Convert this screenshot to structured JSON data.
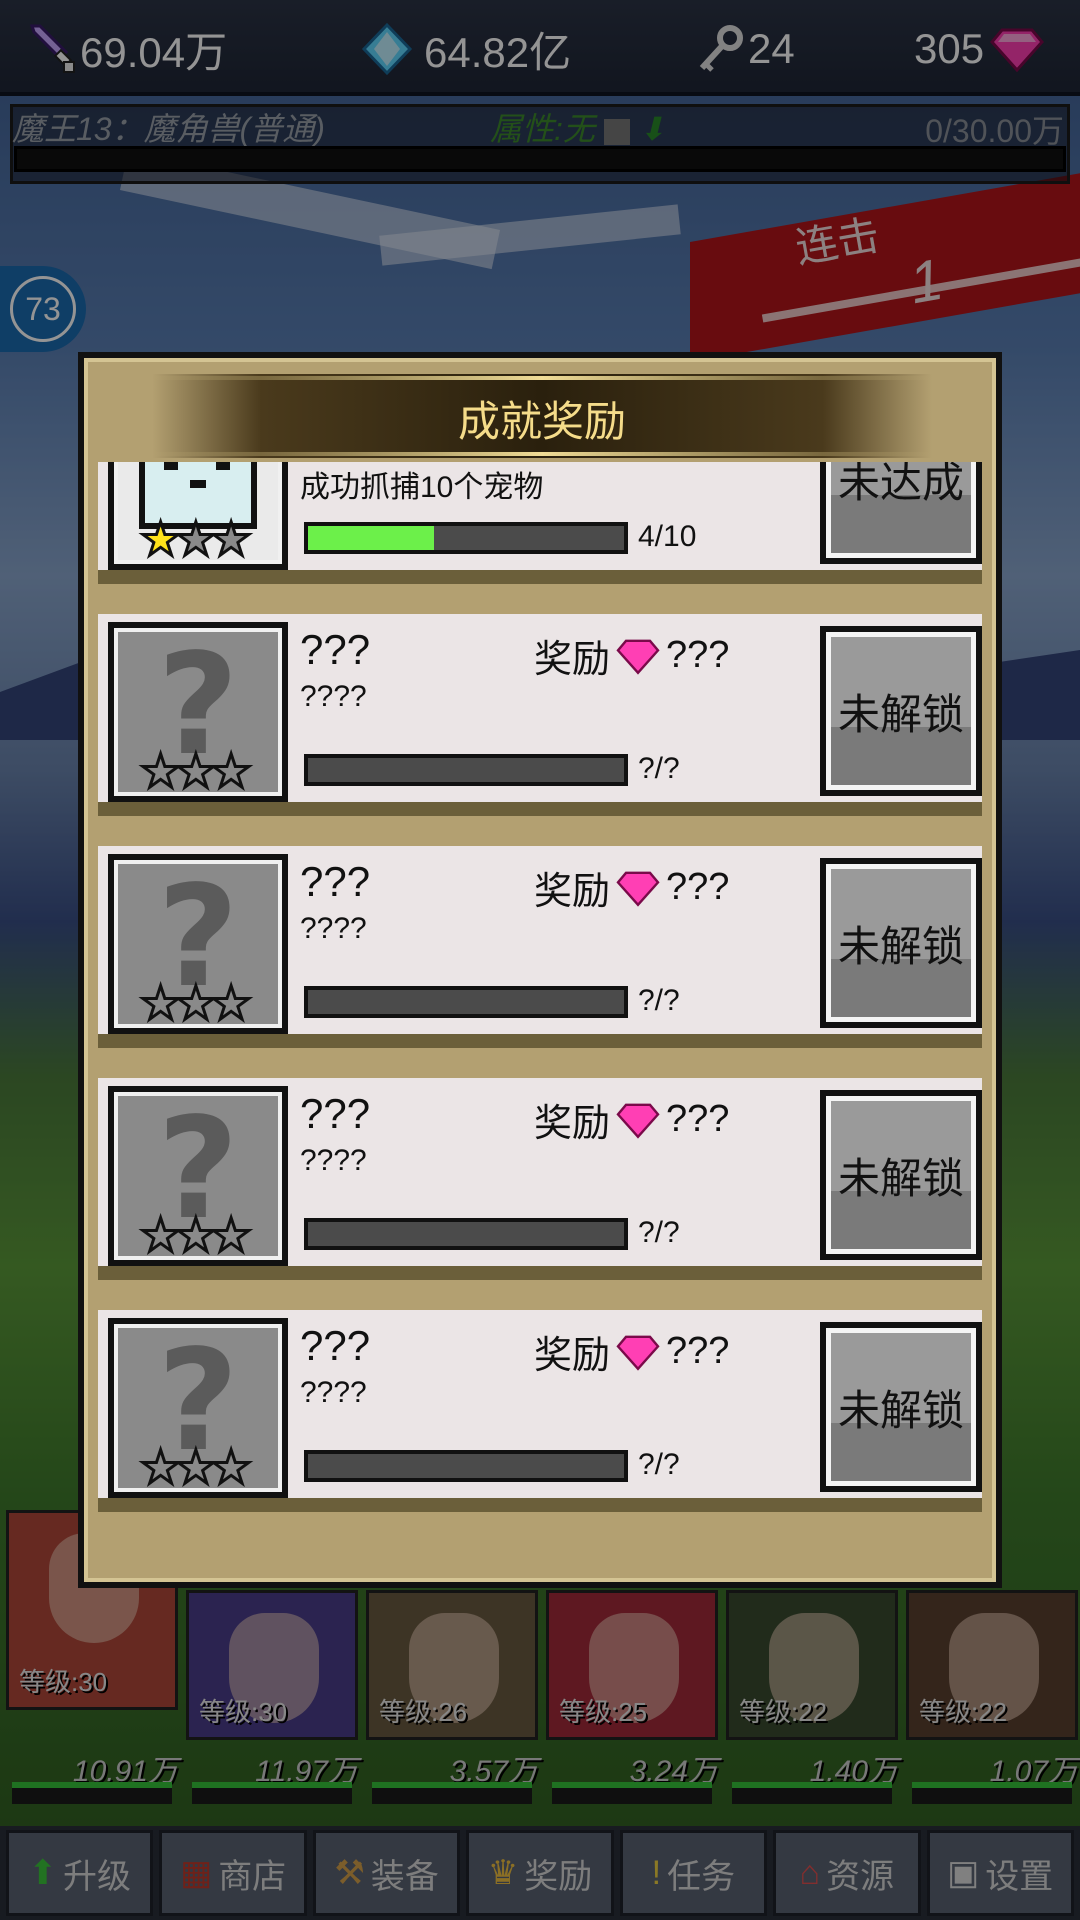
{
  "topbar": {
    "attack_value": "69.04万",
    "crystal_value": "64.82亿",
    "key_value": "24",
    "gem_value": "305",
    "icons": [
      "sword-icon",
      "crystal-icon",
      "key-icon",
      "gem-icon"
    ]
  },
  "boss": {
    "name": "魔王13：魔角兽(普通)",
    "attribute": "属性:无",
    "hp": "0/30.00万"
  },
  "combo": {
    "label": "连击",
    "count": "1"
  },
  "player_level": "73",
  "modal": {
    "title": "成就奖励",
    "first_card": {
      "desc": "成功抓捕10个宠物",
      "progress_text": "4/10",
      "progress": 0.4,
      "stars_on": 1,
      "button": "未达成"
    },
    "locked_cards": [
      {
        "name": "???",
        "reward_label": "奖励",
        "reward_value": "???",
        "desc": "????",
        "progress_text": "?/?",
        "button": "未解锁"
      },
      {
        "name": "???",
        "reward_label": "奖励",
        "reward_value": "???",
        "desc": "????",
        "progress_text": "?/?",
        "button": "未解锁"
      },
      {
        "name": "???",
        "reward_label": "奖励",
        "reward_value": "???",
        "desc": "????",
        "progress_text": "?/?",
        "button": "未解锁"
      },
      {
        "name": "???",
        "reward_label": "奖励",
        "reward_value": "???",
        "desc": "????",
        "progress_text": "?/?",
        "button": "未解锁"
      }
    ]
  },
  "heroes": [
    {
      "level": "等级:30",
      "dps": "10.91万",
      "color": "#b0483a"
    },
    {
      "level": "等级:30",
      "dps": "11.97万",
      "color": "#4a3d8a"
    },
    {
      "level": "等级:26",
      "dps": "3.57万",
      "color": "#6a5a40"
    },
    {
      "level": "等级:25",
      "dps": "3.24万",
      "color": "#a32a3a"
    },
    {
      "level": "等级:22",
      "dps": "1.40万",
      "color": "#3a4a30"
    },
    {
      "level": "等级:22",
      "dps": "1.07万",
      "color": "#5a4030"
    }
  ],
  "nav": [
    "升级",
    "商店",
    "装备",
    "奖励",
    "任务",
    "资源",
    "设置"
  ],
  "colors": {
    "gem": "#ff3fb4",
    "crystal": "#5fd8ff",
    "progress_fill": "#6cf04a",
    "modal_frame": "#b3a071"
  }
}
